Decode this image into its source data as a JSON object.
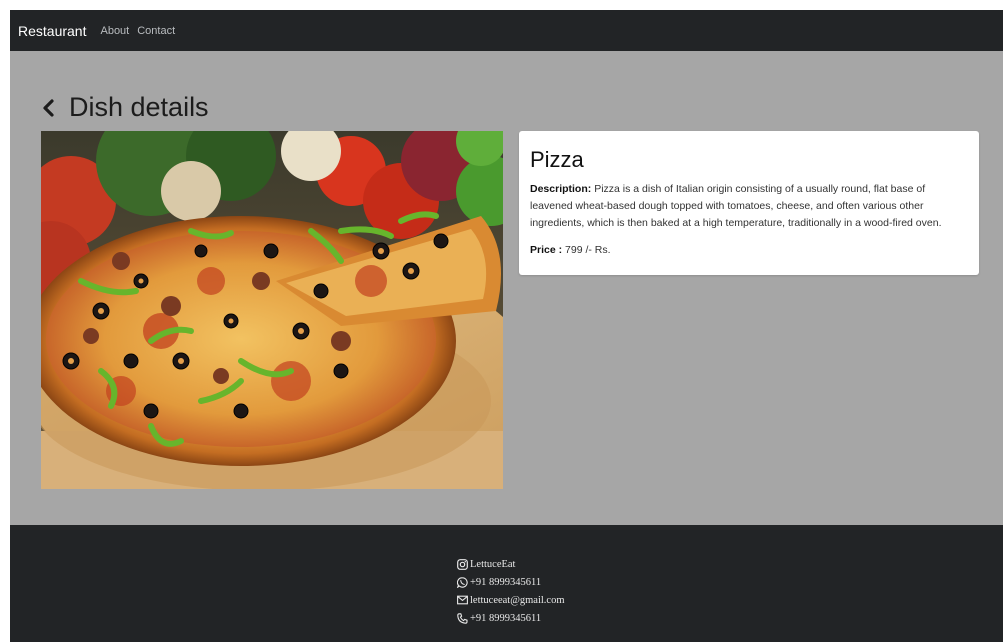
{
  "navbar": {
    "brand": "Restaurant",
    "links": [
      "About",
      "Contact"
    ]
  },
  "page": {
    "title": "Dish details"
  },
  "dish": {
    "name": "Pizza",
    "description_label": "Description:",
    "description": "Pizza is a dish of Italian origin consisting of a usually round, flat base of leavened wheat-based dough topped with tomatoes, cheese, and often various other ingredients, which is then baked at a high temperature, traditionally in a wood-fired oven.",
    "price_label": "Price :",
    "price": "799 /- Rs."
  },
  "footer": {
    "instagram": "LettuceEat",
    "whatsapp": "+91 8999345611",
    "email": "lettuceeat@gmail.com",
    "phone": "+91 8999345611"
  },
  "icons": {
    "back": "chevron-left-icon",
    "instagram": "instagram-icon",
    "whatsapp": "whatsapp-icon",
    "email": "envelope-icon",
    "phone": "phone-icon"
  },
  "colors": {
    "navbar_bg": "#222426",
    "content_bg": "#a6a6a6",
    "card_bg": "#ffffff"
  }
}
